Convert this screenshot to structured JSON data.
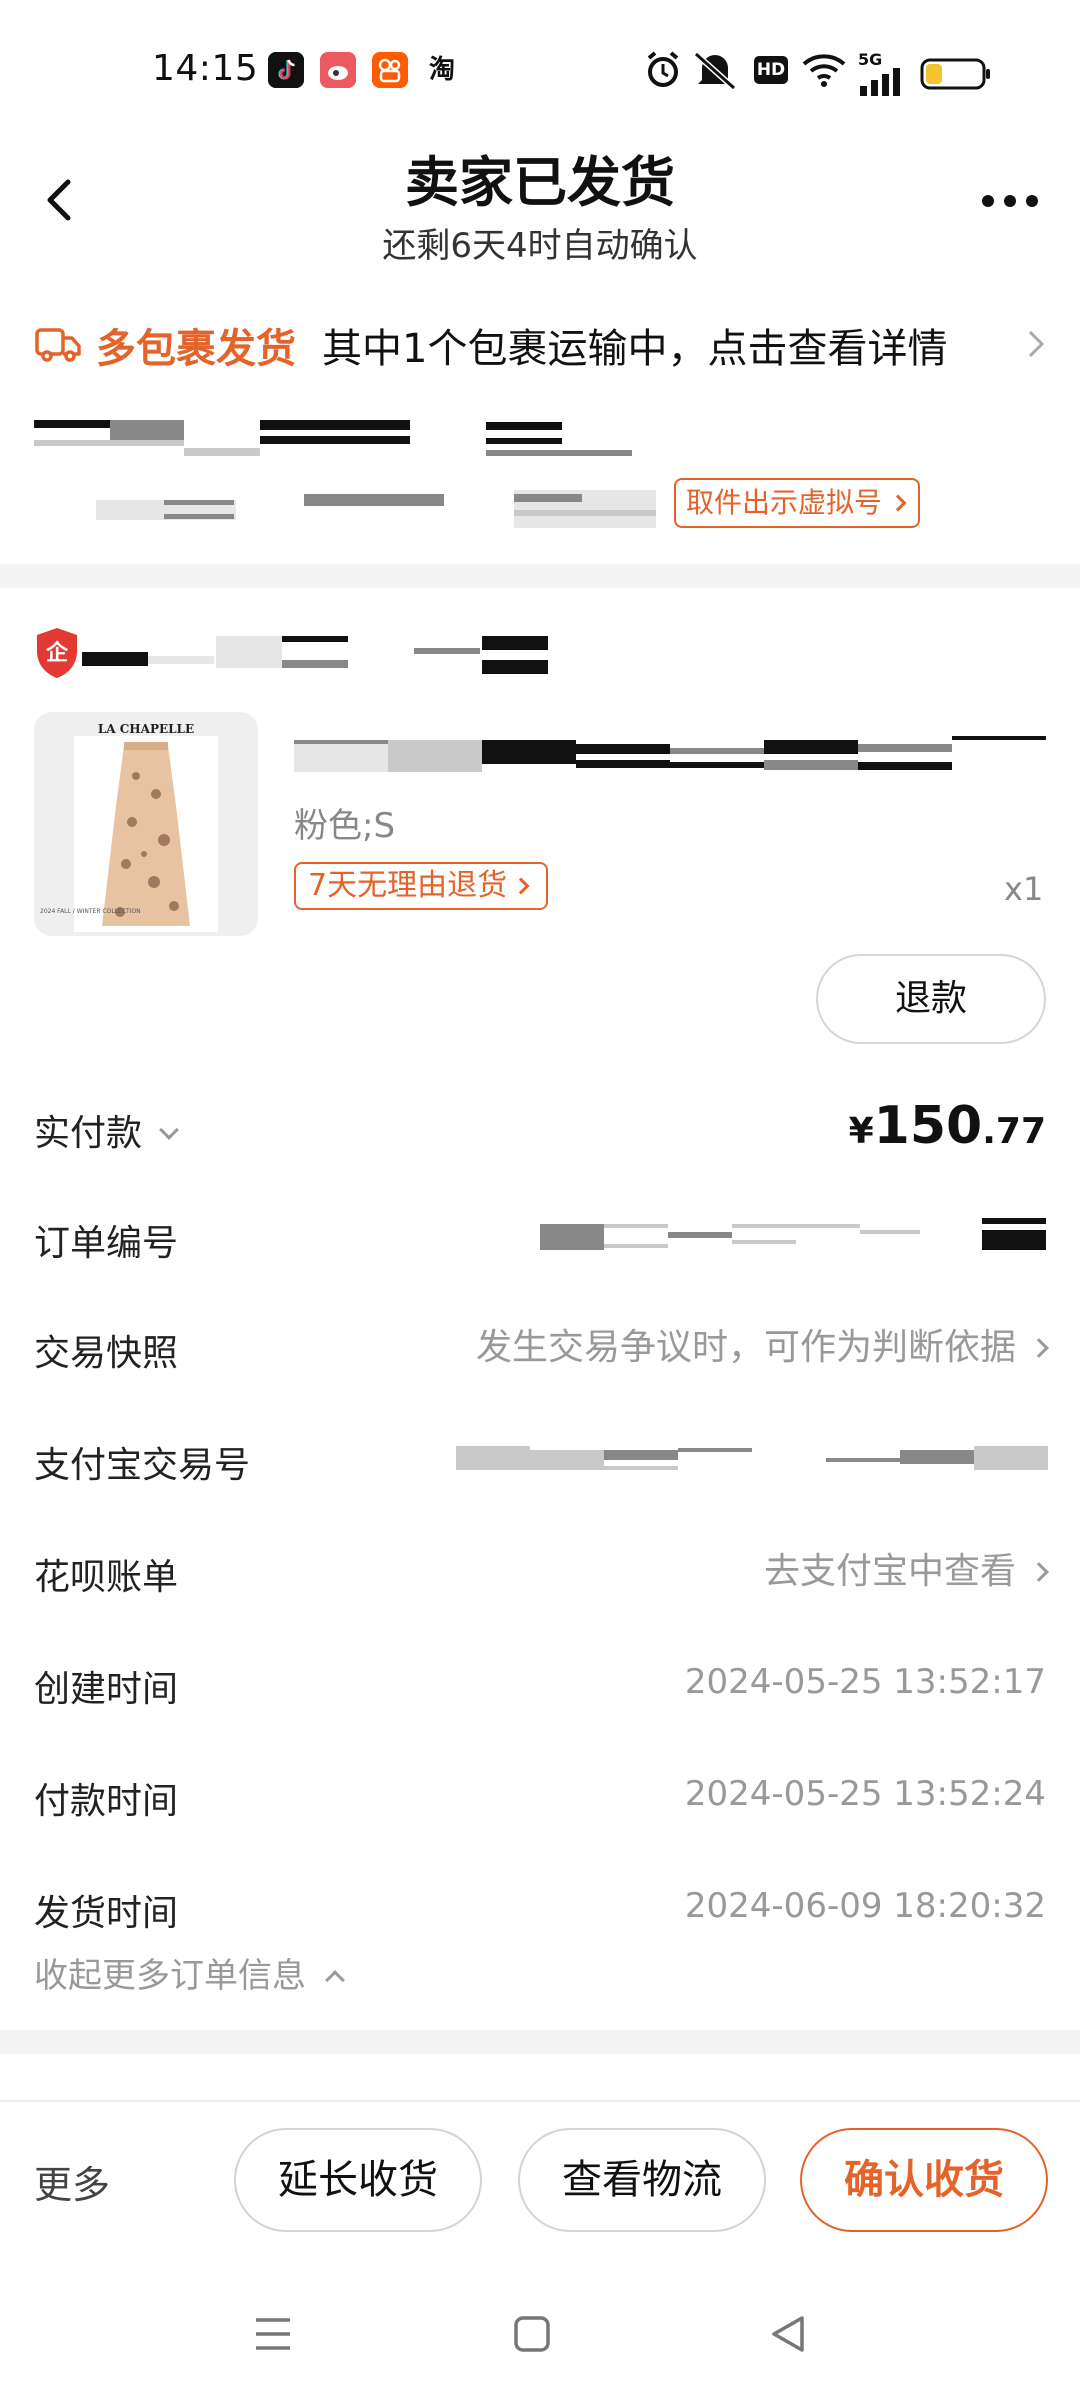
{
  "status_bar": {
    "time": "14:15",
    "apps": [
      "tiktok-icon",
      "weibo-icon",
      "kuaishou-icon",
      "taobao-icon"
    ],
    "taobao_char": "淘",
    "hd_label": "HD",
    "network_label": "5G",
    "battery_level": 0.3
  },
  "header": {
    "title": "卖家已发货",
    "subtitle": "还剩6天4时自动确认"
  },
  "package_banner": {
    "highlight": "多包裹发货",
    "text": "其中1个包裹运输中，点击查看详情"
  },
  "pickup": {
    "virtual_number_button": "取件出示虚拟号"
  },
  "shop": {
    "badge_char": "企"
  },
  "product": {
    "brand": "LA CHAPELLE",
    "caption": "2024 FALL / WINTER COLLECTION",
    "sku": "粉色;S",
    "return_tag": "7天无理由退货",
    "quantity": "x1",
    "refund_button": "退款"
  },
  "order_info": {
    "paid_label": "实付款",
    "price_currency": "¥",
    "price_int": "150",
    "price_dec": ".77",
    "order_no_label": "订单编号",
    "snapshot_label": "交易快照",
    "snapshot_value": "发生交易争议时，可作为判断依据",
    "alipay_no_label": "支付宝交易号",
    "huabei_label": "花呗账单",
    "huabei_value": "去支付宝中查看",
    "created_label": "创建时间",
    "created_value": "2024-05-25 13:52:17",
    "paid_time_label": "付款时间",
    "paid_time_value": "2024-05-25 13:52:24",
    "shipped_label": "发货时间",
    "shipped_value": "2024-06-09 18:20:32",
    "collapse_label": "收起更多订单信息"
  },
  "actions": {
    "more": "更多",
    "extend": "延长收货",
    "logistics": "查看物流",
    "confirm": "确认收货"
  },
  "colors": {
    "accent": "#e4632a",
    "divider": "#f4f4f4",
    "muted": "#999999"
  }
}
